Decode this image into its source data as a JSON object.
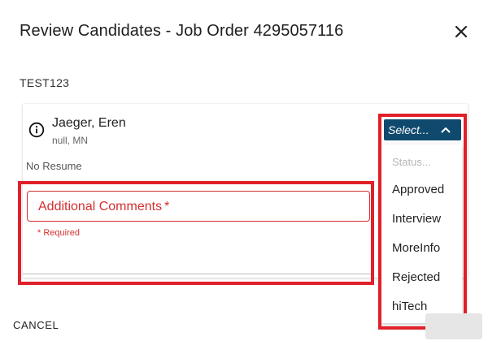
{
  "dialog": {
    "title": "Review Candidates - Job Order 4295057116",
    "order_label": "TEST123"
  },
  "candidate": {
    "name": "Jaeger, Eren",
    "location": "null, MN",
    "resume_status": "No Resume"
  },
  "comments": {
    "label": "Additional Comments",
    "required_marker": "*",
    "error_text": "* Required"
  },
  "status_select": {
    "selected": "Select...",
    "options": [
      "Status...",
      "Approved",
      "Interview",
      "MoreInfo",
      "Rejected",
      "hiTech"
    ]
  },
  "footer": {
    "cancel_label": "CANCEL"
  },
  "colors": {
    "accent": "#0f4a6e",
    "error": "#d32f2f",
    "highlight": "#e0202a"
  },
  "icons": {
    "close": "close-icon",
    "info": "info-icon",
    "chevron": "chevron-up-icon"
  }
}
